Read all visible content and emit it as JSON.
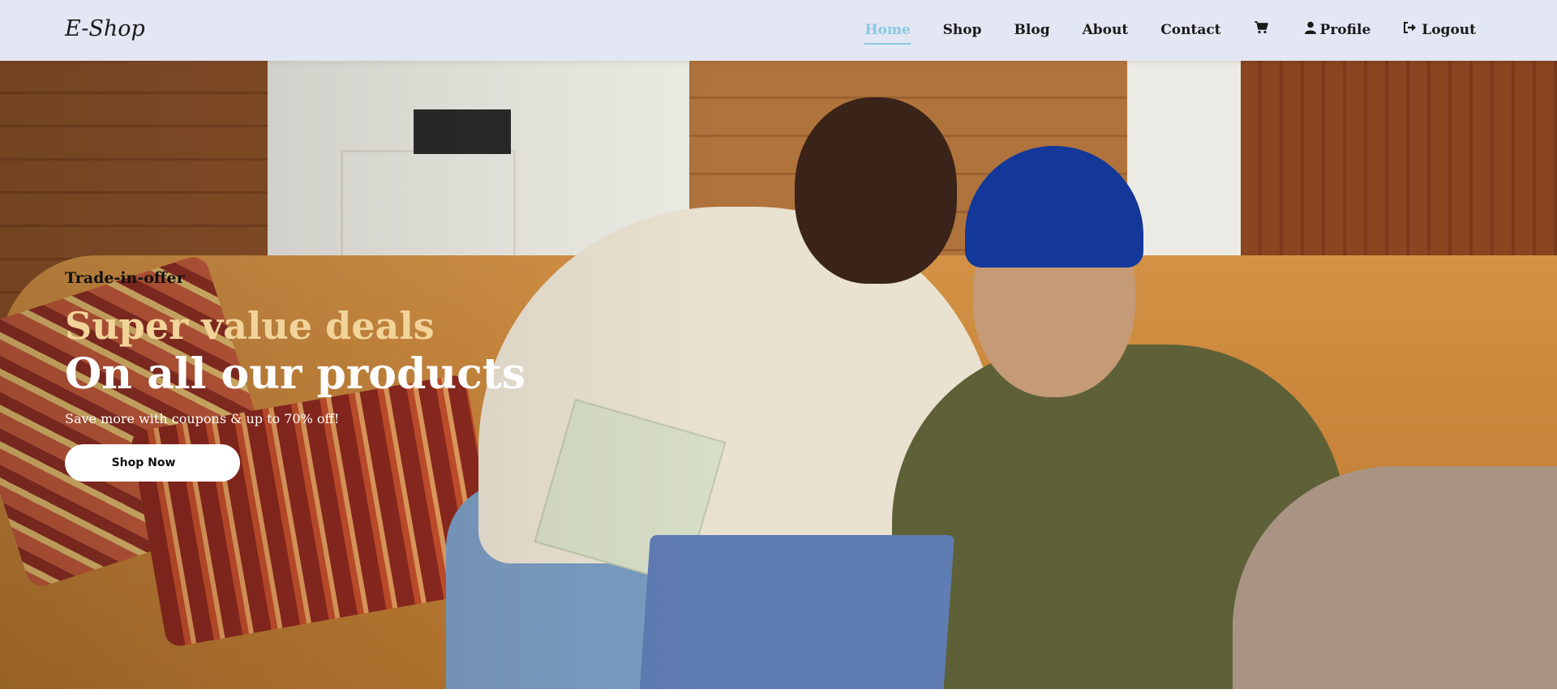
{
  "brand": "E-Shop",
  "nav": {
    "home": "Home",
    "shop": "Shop",
    "blog": "Blog",
    "about": "About",
    "contact": "Contact",
    "cart_icon": "cart-icon",
    "profile": "Profile",
    "profile_icon": "user-icon",
    "logout": "Logout",
    "logout_icon": "logout-icon",
    "active": "Home",
    "active_color": "#88c8e4"
  },
  "hero": {
    "kicker": "Trade-in-offer",
    "headline_1": "Super value deals",
    "headline_2": "On all our products",
    "subtext": "Save more with coupons & up to 70% off!",
    "cta": "Shop Now",
    "headline_1_color": "#f2d49a"
  }
}
